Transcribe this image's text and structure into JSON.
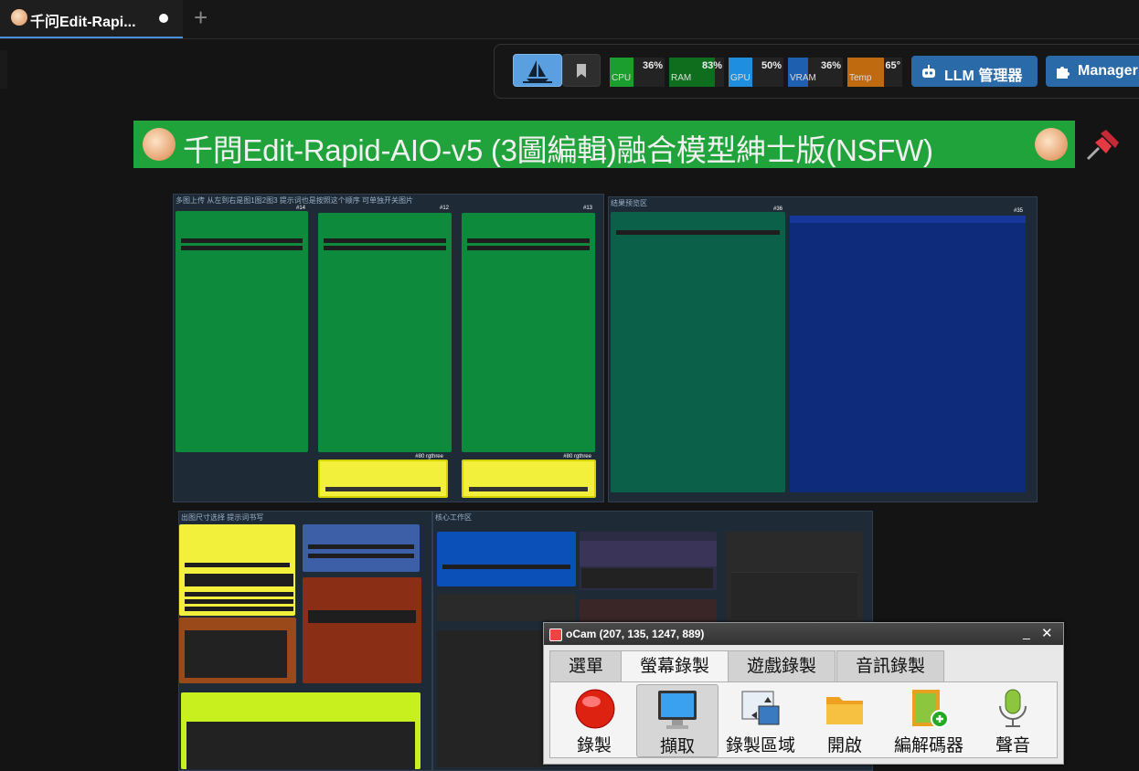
{
  "tab": {
    "title": "千问Edit-Rapi..."
  },
  "toolbar": {
    "stats": [
      {
        "label": "CPU",
        "value": "36%",
        "color": "#1b9e2e"
      },
      {
        "label": "RAM",
        "value": "83%",
        "color": "#0f6e1e"
      },
      {
        "label": "GPU",
        "value": "50%",
        "color": "#1e8fe0"
      },
      {
        "label": "VRAM",
        "value": "36%",
        "color": "#1f5fb0"
      },
      {
        "label": "Temp",
        "value": "65°",
        "color": "#c06a10"
      }
    ],
    "llm_button": "LLM 管理器",
    "manager_button": "Manager"
  },
  "header": {
    "title": "千問Edit-Rapid-AIO-v5 (3圖編輯)融合模型紳士版(NSFW)"
  },
  "groups": {
    "g1": "多图上传 从左到右是图1图2图3 提示词也是按照这个顺序 可单独开关图片",
    "g2": "结果预览区",
    "g3": "出图尺寸选择  提示词书写",
    "g4": "核心工作区"
  },
  "node_ids": {
    "n1": "#14",
    "n2": "#12",
    "n3": "#13",
    "n4": "#36",
    "n5": "#35",
    "y1": "#80 rgthree",
    "y2": "#80 rgthree"
  },
  "ocam": {
    "title": "oCam (207, 135, 1247, 889)",
    "tabs": [
      "選單",
      "螢幕錄製",
      "遊戲錄製",
      "音訊錄製"
    ],
    "active_tab": "螢幕錄製",
    "tools": [
      "錄製",
      "擷取",
      "錄製區域",
      "開啟",
      "編解碼器",
      "聲音"
    ],
    "selected_tool": "擷取"
  }
}
